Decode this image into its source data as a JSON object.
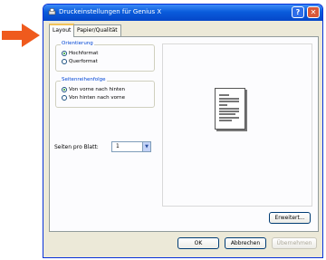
{
  "window": {
    "title": "Druckeinstellungen für Genius X",
    "help_glyph": "?",
    "close_glyph": "✕"
  },
  "tabs": [
    {
      "label": "Layout",
      "active": true
    },
    {
      "label": "Papier/Qualität",
      "active": false
    }
  ],
  "orientation": {
    "label": "Orientierung",
    "options": [
      {
        "label": "Hochformat",
        "selected": true
      },
      {
        "label": "Querformat",
        "selected": false
      }
    ]
  },
  "page_order": {
    "label": "Seitenreihenfolge",
    "options": [
      {
        "label": "Von vorne nach hinten",
        "selected": true
      },
      {
        "label": "Von hinten nach vorne",
        "selected": false
      }
    ]
  },
  "pages_per_sheet": {
    "label": "Seiten pro Blatt:",
    "value": "1"
  },
  "buttons": {
    "advanced": "Erweitert...",
    "ok": "OK",
    "cancel": "Abbrechen",
    "apply": "Übernehmen"
  },
  "colors": {
    "arrow": "#ef5a1d",
    "title_bar": "#0a5cdc",
    "accent": "#0046d5"
  }
}
